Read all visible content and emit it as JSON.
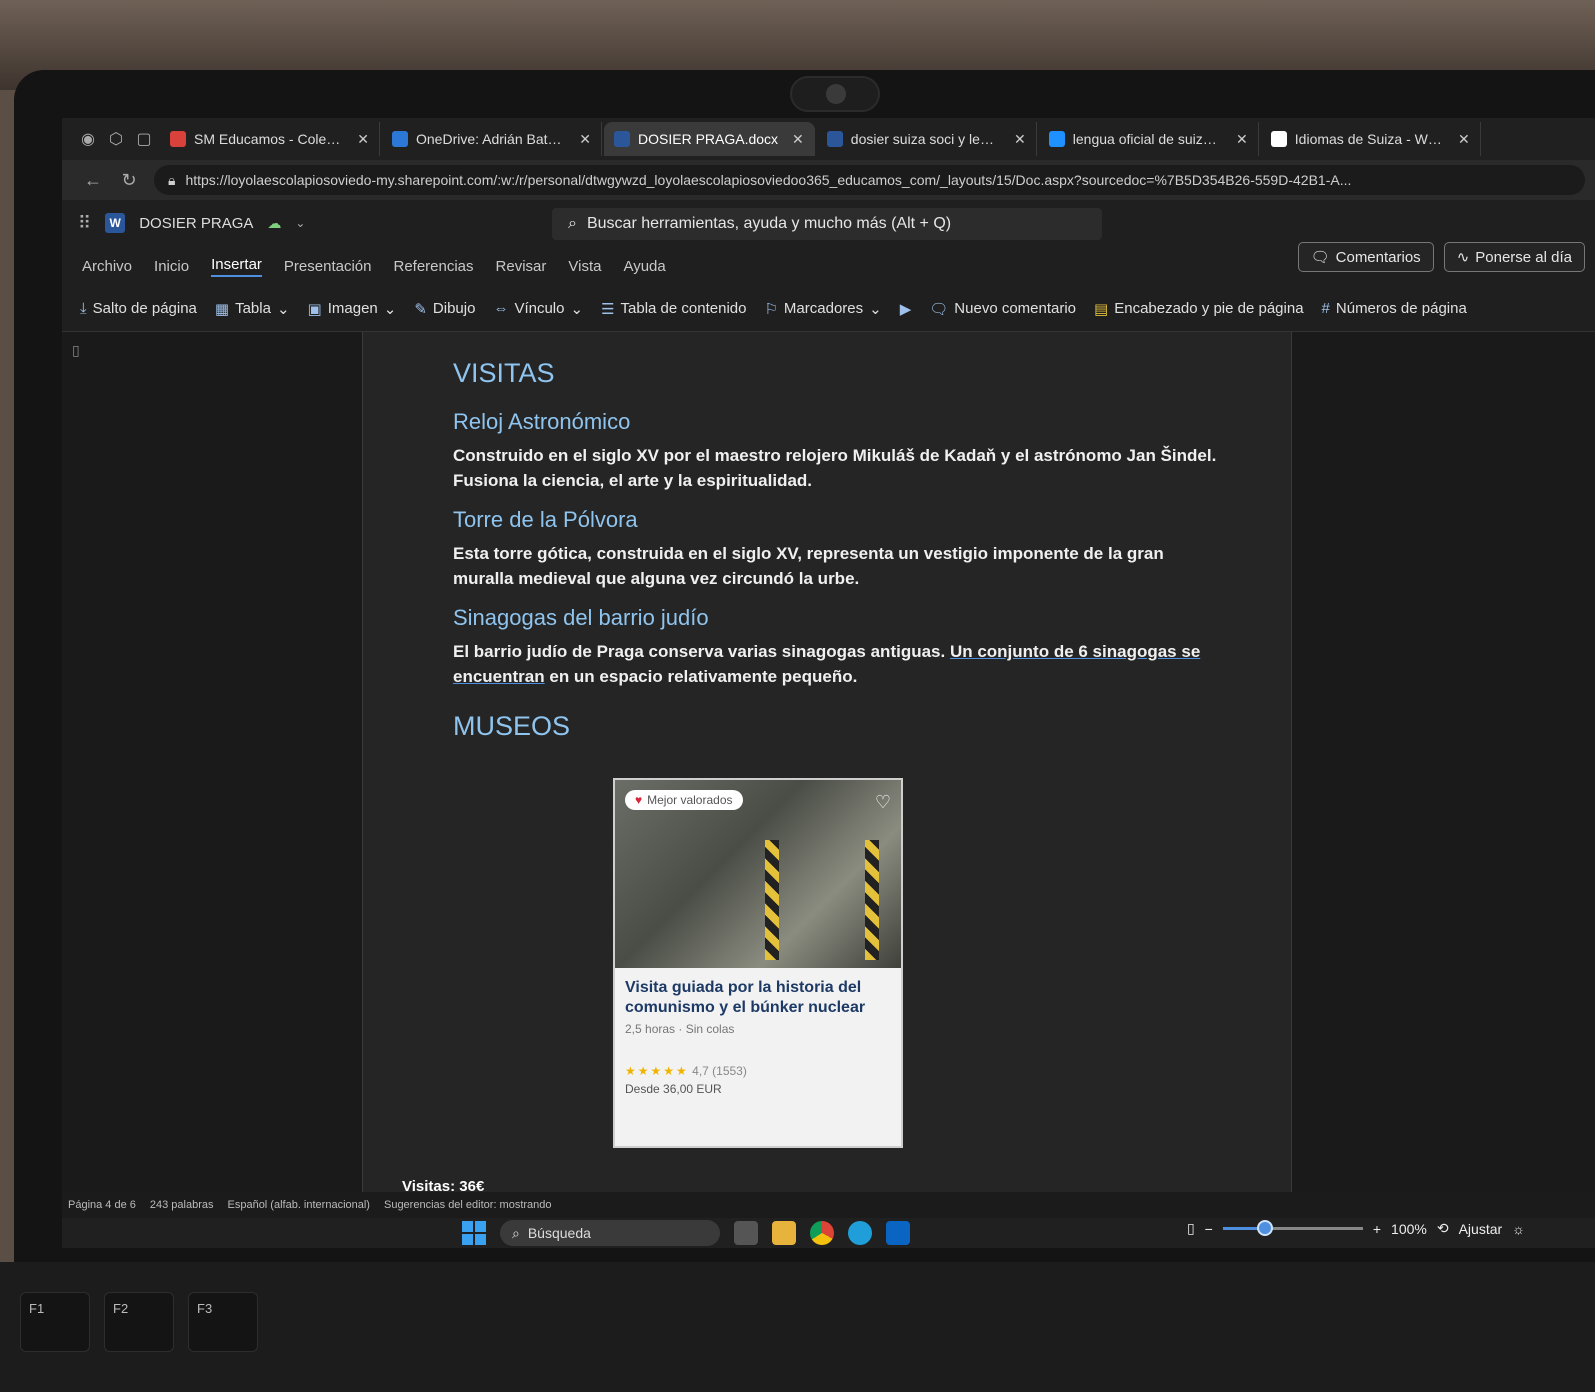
{
  "browser": {
    "tabs": [
      {
        "label": "SM Educamos - Colegio L",
        "favicon_color": "#d9423a",
        "active": false
      },
      {
        "label": "OneDrive: Adrián Batalla /",
        "favicon_color": "#2b78d6",
        "active": false
      },
      {
        "label": "DOSIER PRAGA.docx",
        "favicon_color": "#2b579a",
        "active": true
      },
      {
        "label": "dosier suiza soci y lengua.",
        "favicon_color": "#2b579a",
        "active": false
      },
      {
        "label": "lengua oficial de suiza - B",
        "favicon_color": "#1e90ff",
        "active": false
      },
      {
        "label": "Idiomas de Suiza - Wikipe",
        "favicon_color": "#ffffff",
        "active": false
      }
    ],
    "url": "https://loyolaescolapiosoviedo-my.sharepoint.com/:w:/r/personal/dtwgywzd_loyolaescolapiosoviedoo365_educamos_com/_layouts/15/Doc.aspx?sourcedoc=%7B5D354B26-559D-42B1-A..."
  },
  "word": {
    "doc_title": "DOSIER PRAGA",
    "search_placeholder": "Buscar herramientas, ayuda y mucho más (Alt + Q)",
    "menu": [
      "Archivo",
      "Inicio",
      "Insertar",
      "Presentación",
      "Referencias",
      "Revisar",
      "Vista",
      "Ayuda"
    ],
    "active_menu": "Insertar",
    "ribbon": {
      "page_break": "Salto de página",
      "table": "Tabla",
      "image": "Imagen",
      "drawing": "Dibujo",
      "link": "Vínculo",
      "toc": "Tabla de contenido",
      "bookmarks": "Marcadores",
      "new_comment": "Nuevo comentario",
      "header_footer": "Encabezado y pie de página",
      "page_numbers": "Números de página"
    },
    "comments_button": "Comentarios",
    "catch_up_button": "Ponerse al día"
  },
  "document": {
    "heading_visitas": "VISITAS",
    "sections": [
      {
        "title": "Reloj Astronómico",
        "text": "Construido en el siglo XV por el maestro relojero Mikuláš de Kadaň y el astrónomo Jan Šindel. Fusiona la ciencia, el arte y la espiritualidad."
      },
      {
        "title": "Torre de la Pólvora",
        "text": "Esta torre gótica, construida en el siglo XV, representa un vestigio imponente de la gran muralla medieval que alguna vez circundó la urbe."
      },
      {
        "title": "Sinagogas del barrio judío",
        "text_before": "El barrio judío de Praga conserva varias sinagogas antiguas. ",
        "text_link": "Un conjunto de 6 sinagogas se encuentran",
        "text_after": " en un espacio relativamente pequeño."
      }
    ],
    "heading_museos": "MUSEOS",
    "card": {
      "badge": "Mejor valorados",
      "title": "Visita guiada por la historia del comunismo y el búnker nuclear",
      "meta": "2,5 horas · Sin colas",
      "stars": "★★★★★",
      "rating": "4,7 (1553)",
      "price": "Desde 36,00 EUR"
    },
    "visits_note": "Visitas: 36€"
  },
  "status": {
    "page": "Página 4 de 6",
    "words": "243 palabras",
    "language": "Español (alfab. internacional)",
    "editor": "Sugerencias del editor: mostrando"
  },
  "taskbar": {
    "search": "Búsqueda",
    "zoom": "100%",
    "zoom_fraction": 0.3,
    "fit": "Ajustar"
  },
  "keys": [
    "F1",
    "F2",
    "F3"
  ]
}
